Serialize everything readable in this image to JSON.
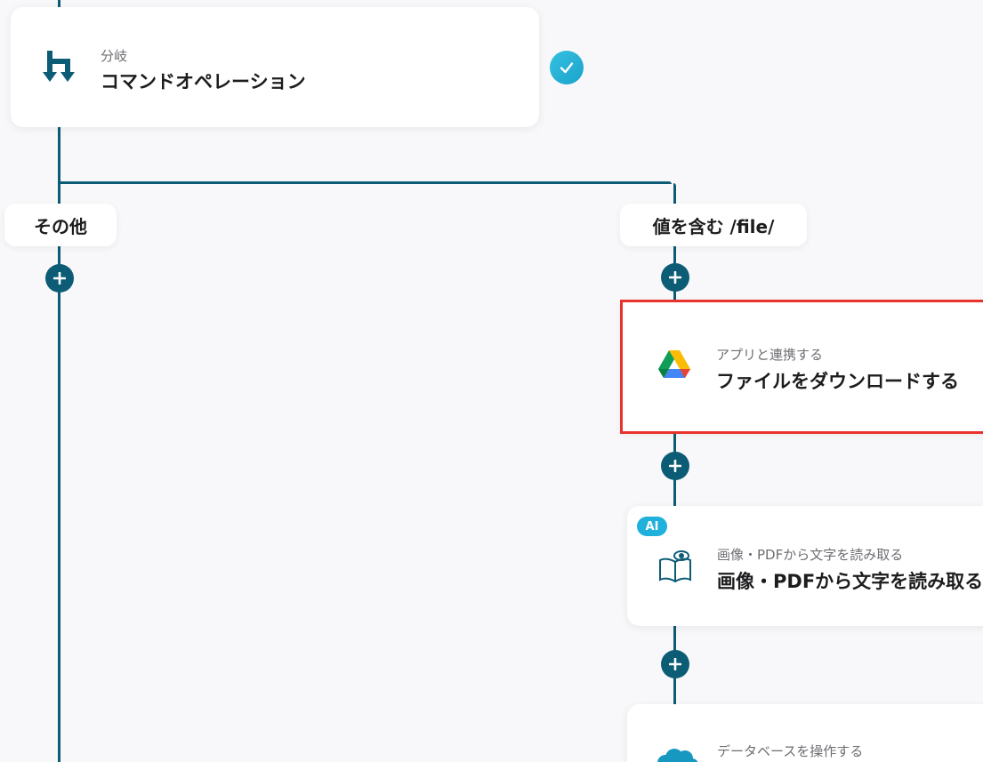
{
  "branch_node": {
    "subtitle": "分岐",
    "title": "コマンドオペレーション",
    "icon": "branch-icon",
    "status": "check-icon"
  },
  "branches": {
    "left_label": "その他",
    "right_label": "値を含む /file/"
  },
  "steps": [
    {
      "subtitle": "アプリと連携する",
      "title": "ファイルをダウンロードする",
      "icon": "google-drive-icon",
      "highlighted": true
    },
    {
      "badge": "AI",
      "subtitle": "画像・PDFから文字を読み取る",
      "title": "画像・PDFから文字を読み取る",
      "icon": "book-eye-icon"
    },
    {
      "subtitle": "データベースを操作する",
      "title": "",
      "icon": "salesforce-cloud-icon"
    }
  ],
  "colors": {
    "flow_line": "#0d5c76",
    "highlight": "#e8322b",
    "check": "#1aa3cc",
    "ai_badge": "#1fb1dc"
  }
}
